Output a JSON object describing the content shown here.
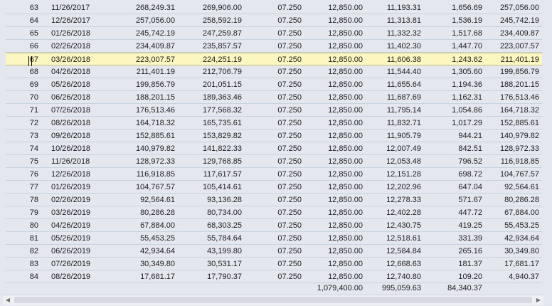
{
  "table": {
    "rows": [
      [
        "63",
        "11/26/2017",
        "268,249.31",
        "269,906.00",
        "07.250",
        "12,850.00",
        "11,193.31",
        "1,656.69",
        "257,056.00"
      ],
      [
        "64",
        "12/26/2017",
        "257,056.00",
        "258,592.19",
        "07.250",
        "12,850.00",
        "11,313.81",
        "1,536.19",
        "245,742.19"
      ],
      [
        "65",
        "01/26/2018",
        "245,742.19",
        "247,259.87",
        "07.250",
        "12,850.00",
        "11,332.32",
        "1,517.68",
        "234,409.87"
      ],
      [
        "66",
        "02/26/2018",
        "234,409.87",
        "235,857.57",
        "07.250",
        "12,850.00",
        "11,402.30",
        "1,447.70",
        "223,007.57"
      ],
      [
        "67",
        "03/26/2018",
        "223,007.57",
        "224,251.19",
        "07.250",
        "12,850.00",
        "11,606.38",
        "1,243.62",
        "211,401.19"
      ],
      [
        "68",
        "04/26/2018",
        "211,401.19",
        "212,706.79",
        "07.250",
        "12,850.00",
        "11,544.40",
        "1,305.60",
        "199,856.79"
      ],
      [
        "69",
        "05/26/2018",
        "199,856.79",
        "201,051.15",
        "07.250",
        "12,850.00",
        "11,655.64",
        "1,194.36",
        "188,201.15"
      ],
      [
        "70",
        "06/26/2018",
        "188,201.15",
        "189,363.46",
        "07.250",
        "12,850.00",
        "11,687.69",
        "1,162.31",
        "176,513.46"
      ],
      [
        "71",
        "07/26/2018",
        "176,513.46",
        "177,568.32",
        "07.250",
        "12,850.00",
        "11,795.14",
        "1,054.86",
        "164,718.32"
      ],
      [
        "72",
        "08/26/2018",
        "164,718.32",
        "165,735.61",
        "07.250",
        "12,850.00",
        "11,832.71",
        "1,017.29",
        "152,885.61"
      ],
      [
        "73",
        "09/26/2018",
        "152,885.61",
        "153,829.82",
        "07.250",
        "12,850.00",
        "11,905.79",
        "944.21",
        "140,979.82"
      ],
      [
        "74",
        "10/26/2018",
        "140,979.82",
        "141,822.33",
        "07.250",
        "12,850.00",
        "12,007.49",
        "842.51",
        "128,972.33"
      ],
      [
        "75",
        "11/26/2018",
        "128,972.33",
        "129,768.85",
        "07.250",
        "12,850.00",
        "12,053.48",
        "796.52",
        "116,918.85"
      ],
      [
        "76",
        "12/26/2018",
        "116,918.85",
        "117,617.57",
        "07.250",
        "12,850.00",
        "12,151.28",
        "698.72",
        "104,767.57"
      ],
      [
        "77",
        "01/26/2019",
        "104,767.57",
        "105,414.61",
        "07.250",
        "12,850.00",
        "12,202.96",
        "647.04",
        "92,564.61"
      ],
      [
        "78",
        "02/26/2019",
        "92,564.61",
        "93,136.28",
        "07.250",
        "12,850.00",
        "12,278.33",
        "571.67",
        "80,286.28"
      ],
      [
        "79",
        "03/26/2019",
        "80,286.28",
        "80,734.00",
        "07.250",
        "12,850.00",
        "12,402.28",
        "447.72",
        "67,884.00"
      ],
      [
        "80",
        "04/26/2019",
        "67,884.00",
        "68,303.25",
        "07.250",
        "12,850.00",
        "12,430.75",
        "419.25",
        "55,453.25"
      ],
      [
        "81",
        "05/26/2019",
        "55,453.25",
        "55,784.64",
        "07.250",
        "12,850.00",
        "12,518.61",
        "331.39",
        "42,934.64"
      ],
      [
        "82",
        "06/26/2019",
        "42,934.64",
        "43,199.80",
        "07.250",
        "12,850.00",
        "12,584.84",
        "265.16",
        "30,349.80"
      ],
      [
        "83",
        "07/26/2019",
        "30,349.80",
        "30,531.17",
        "07.250",
        "12,850.00",
        "12,668.63",
        "181.37",
        "17,681.17"
      ],
      [
        "84",
        "08/26/2019",
        "17,681.17",
        "17,790.37",
        "07.250",
        "12,850.00",
        "12,740.80",
        "109.20",
        "4,940.37"
      ]
    ],
    "selected_index": 4,
    "totals": {
      "payment": "1,079,400.00",
      "principal": "995,059.63",
      "interest": "84,340.37"
    }
  },
  "scrollbar": {
    "left_icon": "arrow-left-icon",
    "right_icon": "arrow-right-icon"
  }
}
